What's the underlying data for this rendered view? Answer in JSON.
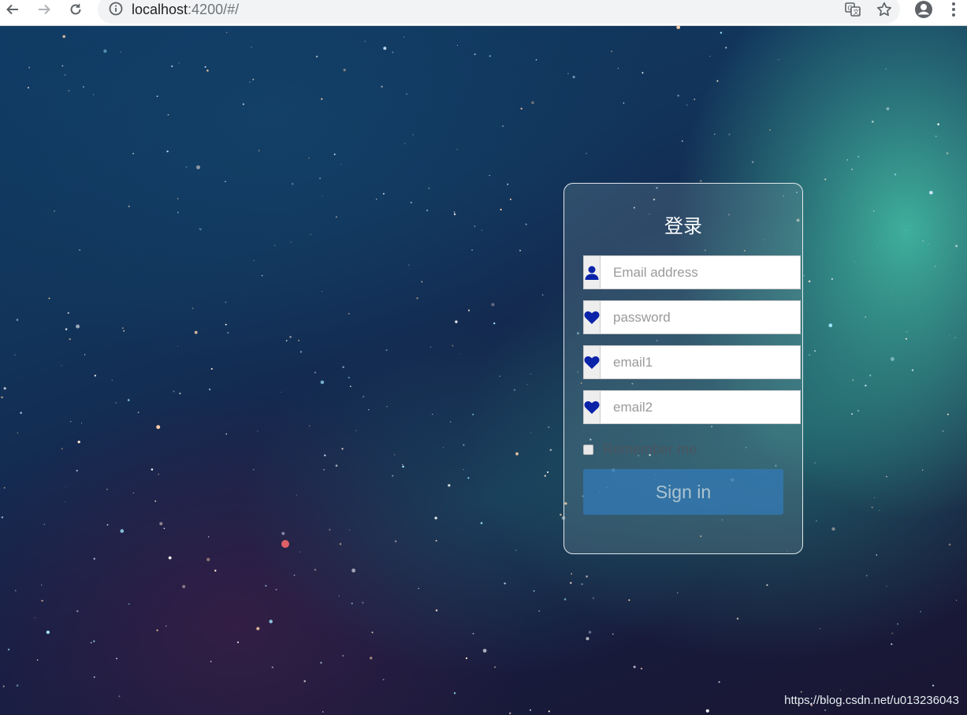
{
  "browser": {
    "url_host": "localhost",
    "url_rest": ":4200/#/",
    "icons": [
      "back-arrow-icon",
      "forward-arrow-icon",
      "reload-icon",
      "info-icon",
      "translate-icon",
      "star-icon",
      "account-icon",
      "menu-dots-icon"
    ]
  },
  "login": {
    "title": "登录",
    "fields": [
      {
        "placeholder": "Email address",
        "icon": "user-icon"
      },
      {
        "placeholder": "password",
        "icon": "heart-icon"
      },
      {
        "placeholder": "email1",
        "icon": "heart-icon"
      },
      {
        "placeholder": "email2",
        "icon": "heart-icon"
      }
    ],
    "remember_label": "Remember me",
    "remember_checked": false,
    "submit_label": "Sign in"
  },
  "watermark": "https://blog.csdn.net/u013236043",
  "colors": {
    "icon_blue": "#0a23a8",
    "button": "#337ab7"
  }
}
